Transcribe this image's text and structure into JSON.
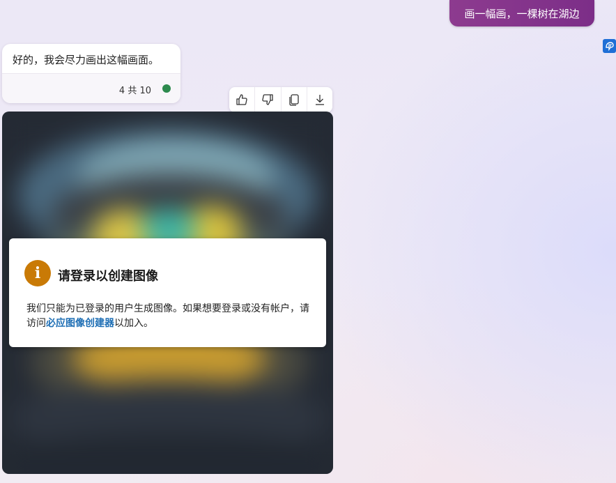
{
  "user_message": {
    "text": "画一幅画，一棵树在湖边"
  },
  "bot_message": {
    "text": "好的，我会尽力画出这幅画面。",
    "counter": "4 共 10",
    "status_color": "#2d8a4e"
  },
  "actions": [
    {
      "icon": "thumbs-up-icon"
    },
    {
      "icon": "thumbs-down-icon"
    },
    {
      "icon": "copy-icon"
    },
    {
      "icon": "download-icon"
    }
  ],
  "login_dialog": {
    "icon": "info-icon",
    "icon_glyph": "i",
    "title": "请登录以创建图像",
    "body_before": "我们只能为已登录的用户生成图像。如果想要登录或没有帐户，请访问",
    "link_text": "必应图像创建器",
    "body_after": "以加入。"
  },
  "colors": {
    "user_bubble": "#8d3b8f",
    "info_icon": "#c97a06",
    "link": "#1f6fb5",
    "side_icon": "#1f6fd6"
  }
}
